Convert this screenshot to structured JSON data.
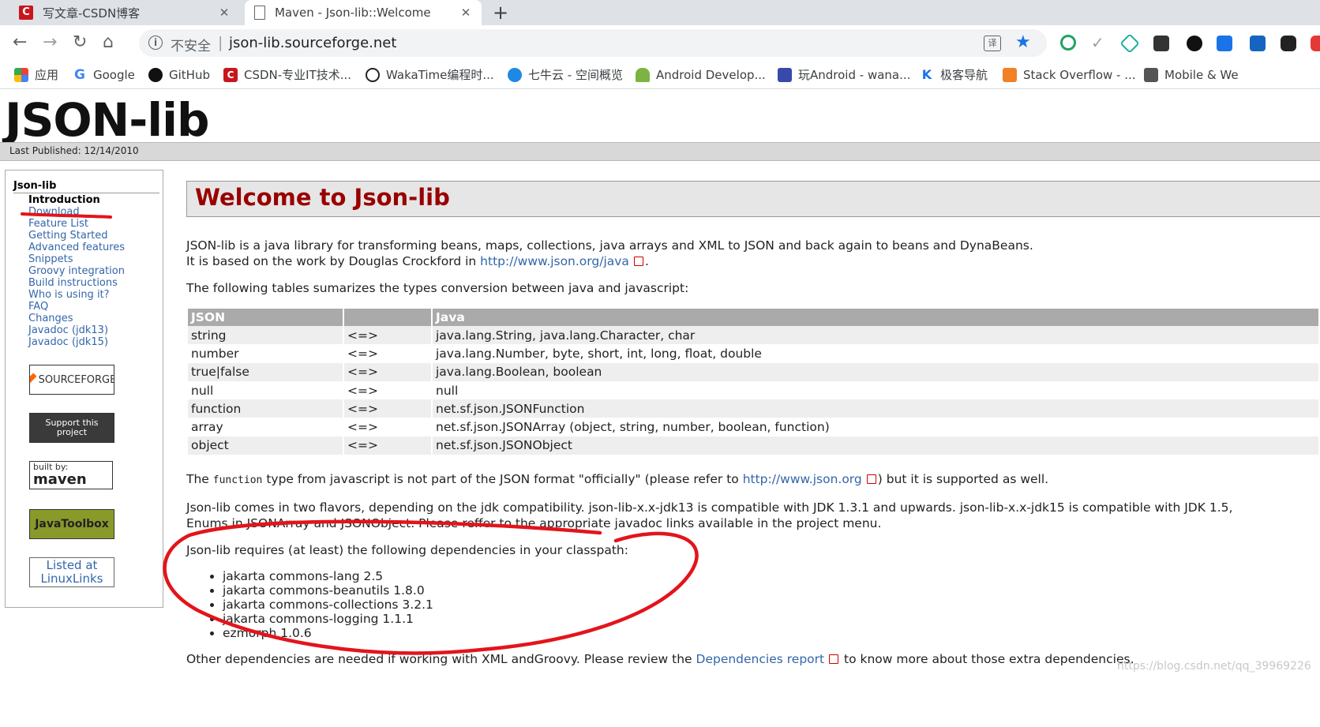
{
  "browser": {
    "tabs": [
      {
        "title": "写文章-CSDN博客",
        "active": false,
        "favicon": "csdn-icon"
      },
      {
        "title": "Maven - Json-lib::Welcome",
        "active": true,
        "favicon": "page-icon"
      }
    ],
    "close_glyph": "✕",
    "newtab_glyph": "+",
    "nav": {
      "back": "←",
      "forward": "→",
      "reload": "↻",
      "home": "⌂"
    },
    "address": {
      "security_label": "不安全",
      "separator": "|",
      "url": "json-lib.sourceforge.net",
      "info_glyph": "i",
      "translate_glyph": "译",
      "star_glyph": "★"
    },
    "bookmarks": [
      {
        "label": "应用",
        "icon": "apps-icon"
      },
      {
        "label": "Google",
        "icon": "google-icon"
      },
      {
        "label": "GitHub",
        "icon": "github-icon"
      },
      {
        "label": "CSDN-专业IT技术...",
        "icon": "csdn-icon"
      },
      {
        "label": "WakaTime编程时...",
        "icon": "wakatime-icon"
      },
      {
        "label": "七牛云 - 空间概览",
        "icon": "qiniu-icon"
      },
      {
        "label": "Android Develop...",
        "icon": "android-icon"
      },
      {
        "label": "玩Android - wana...",
        "icon": "wanandroid-icon"
      },
      {
        "label": "极客导航",
        "icon": "jike-icon"
      },
      {
        "label": "Stack Overflow - ...",
        "icon": "stackoverflow-icon"
      },
      {
        "label": "Mobile & We",
        "icon": "mobile-icon"
      }
    ]
  },
  "page": {
    "logo": "JSON-lib",
    "last_published": "Last Published: 12/14/2010",
    "nav": {
      "heading": "Json-lib",
      "items": [
        {
          "label": "Introduction",
          "current": true
        },
        {
          "label": "Download"
        },
        {
          "label": "Feature List"
        },
        {
          "label": "Getting Started"
        },
        {
          "label": "Advanced features"
        },
        {
          "label": "Snippets"
        },
        {
          "label": "Groovy integration"
        },
        {
          "label": "Build instructions"
        },
        {
          "label": "Who is using it?"
        },
        {
          "label": "FAQ"
        },
        {
          "label": "Changes"
        },
        {
          "label": "Javadoc (jdk13)"
        },
        {
          "label": "Javadoc (jdk15)"
        }
      ]
    },
    "badges": {
      "sourceforge": "SOURCEFORGE",
      "support_line1": "Support this",
      "support_line2": "project",
      "maven_small": "built by:",
      "maven_big": "maven",
      "javatoolbox": "JavaToolbox",
      "linuxlinks_line1": "Listed at",
      "linuxlinks_line2": "LinuxLinks"
    },
    "heading": "Welcome to Json-lib",
    "intro_line1": "JSON-lib is a java library for transforming beans, maps, collections, java arrays and XML to JSON and back again to beans and DynaBeans.",
    "intro_line2_pre": "It is based on the work by Douglas Crockford in ",
    "intro_line2_link": "http://www.json.org/java",
    "intro_line2_post": ".",
    "tables_intro": "The following tables sumarizes the types conversion between java and javascript:",
    "table": {
      "headers": [
        "JSON",
        "",
        "Java"
      ],
      "rows": [
        [
          "string",
          "<=>",
          "java.lang.String, java.lang.Character, char"
        ],
        [
          "number",
          "<=>",
          "java.lang.Number, byte, short, int, long, float, double"
        ],
        [
          "true|false",
          "<=>",
          "java.lang.Boolean, boolean"
        ],
        [
          "null",
          "<=>",
          "null"
        ],
        [
          "function",
          "<=>",
          "net.sf.json.JSONFunction"
        ],
        [
          "array",
          "<=>",
          "net.sf.json.JSONArray (object, string, number, boolean, function)"
        ],
        [
          "object",
          "<=>",
          "net.sf.json.JSONObject"
        ]
      ]
    },
    "function_note_pre": "The ",
    "function_note_code": "function",
    "function_note_mid": " type from javascript is not part of the JSON format \"officially\" (please refer to ",
    "function_note_link": "http://www.json.org",
    "function_note_post": ") but it is supported as well.",
    "flavors_line1": "Json-lib comes in two flavors, depending on the jdk compatibility. json-lib-x.x-jdk13 is compatible with JDK 1.3.1 and upwards. json-lib-x.x-jdk15 is compatible with JDK 1.5,",
    "flavors_line2": "Enums in JSONArray and JSONObject. Please reffer to the appropriate javadoc links available in the project menu.",
    "deps_intro": "Json-lib requires (at least) the following dependencies in your classpath:",
    "dependencies": [
      "jakarta commons-lang 2.5",
      "jakarta commons-beanutils 1.8.0",
      "jakarta commons-collections 3.2.1",
      "jakarta commons-logging 1.1.1",
      "ezmorph 1.0.6"
    ],
    "other_pre": "Other dependencies are needed if working with XML andGroovy. Please review the ",
    "other_link": "Dependencies report",
    "other_post": " to know more about those extra dependencies.",
    "watermark": "https://blog.csdn.net/qq_39969226"
  },
  "colors": {
    "annotation_red": "#e3141b",
    "link": "#3366aa",
    "heading": "#990000"
  }
}
